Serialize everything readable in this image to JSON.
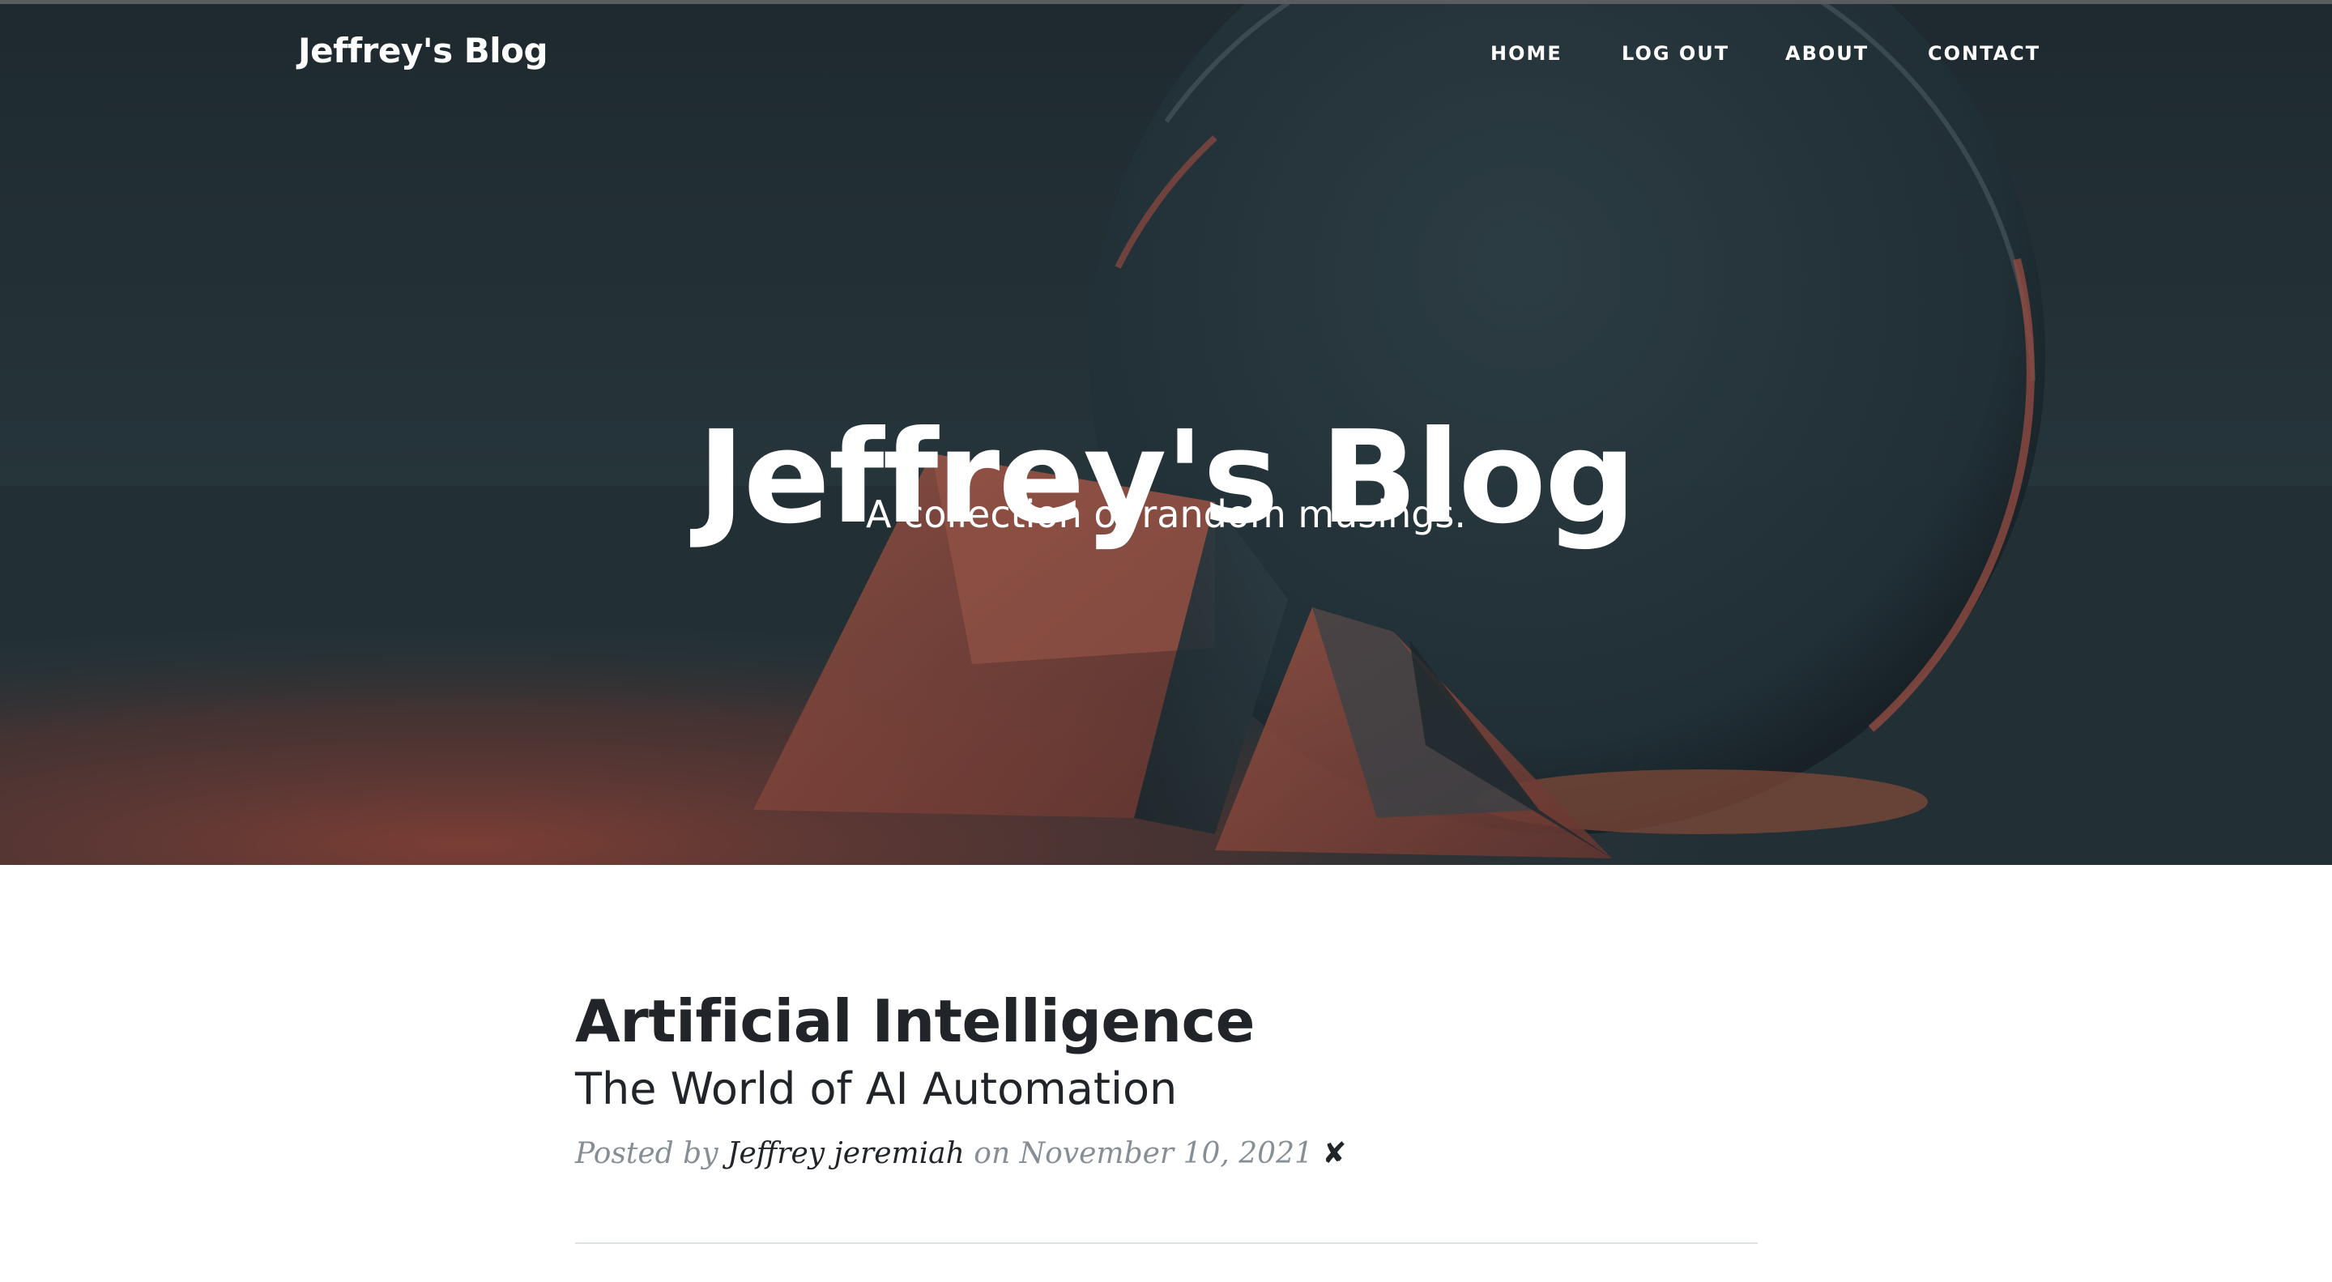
{
  "navbar": {
    "brand": "Jeffrey's Blog",
    "links": [
      "HOME",
      "LOG OUT",
      "ABOUT",
      "CONTACT"
    ]
  },
  "hero": {
    "title": "Jeffrey's Blog",
    "subtitle": "A collection of random musings."
  },
  "posts": [
    {
      "title": "Artificial Intelligence",
      "subtitle": "The World of AI Automation",
      "meta_prefix": "Posted by",
      "author": "Jeffrey jeremiah",
      "meta_on": "on",
      "date": "November 10, 2021",
      "delete_glyph": "✘"
    }
  ],
  "colors": {
    "hero_overlay": "#2b3b40",
    "accent_red": "#b5523f",
    "text_dark": "#212529",
    "text_muted": "#868e96"
  }
}
